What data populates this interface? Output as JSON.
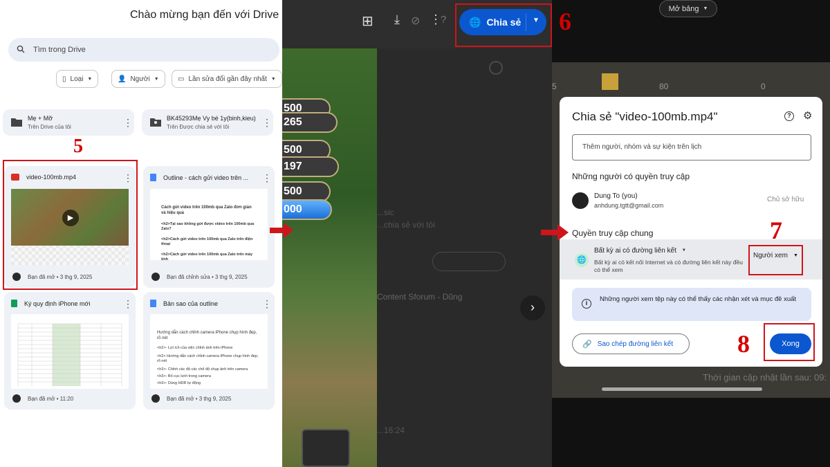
{
  "drive": {
    "welcome": "Chào mừng bạn đến với Drive",
    "search_placeholder": "Tìm trong Drive",
    "filters": [
      "Loại",
      "Người",
      "Lần sửa đổi gần đây nhất"
    ],
    "folders": [
      {
        "name": "Mẹ + Mỡ",
        "location": "Trên Drive của tôi"
      },
      {
        "name": "BK45293Mẹ Vy bé 1y(binh,kieu)",
        "location": "Trên Được chia sẻ với tôi"
      }
    ],
    "files": [
      {
        "name": "video-100mb.mp4",
        "activity": "Bạn đã mở • 3 thg 9, 2025",
        "icon": "video-icon"
      },
      {
        "name": "Outline - cách gửi video trên ...",
        "activity": "Bạn đã chỉnh sửa • 3 thg 9, 2025",
        "icon": "doc-icon"
      },
      {
        "name": "Ký quy định iPhone mới",
        "activity": "Bạn đã mở • 11:20",
        "icon": "sheet-icon"
      },
      {
        "name": "Bản sao của outline",
        "activity": "Bạn đã mở • 3 thg 9, 2025",
        "icon": "doc-icon"
      }
    ],
    "outline_preview": [
      "Cách gửi video trên 100mb qua Zalo đơn giản và hiệu quả",
      "<h2>Tại sao không gửi được video trên 100mb qua Zalo?",
      "<h2>Cách gửi video trên 100mb qua Zalo trên điện thoại",
      "<h2>Cách gửi video trên 100mb qua Zalo trên máy tính"
    ],
    "copy_preview": [
      "Hướng dẫn cách chỉnh camera iPhone chụp hình đẹp, rõ nét",
      "<h2>- Lợi ích của việc chỉnh ảnh trên iPhone",
      "<h2> Hướng dẫn cách chỉnh camera iPhone chụp hình đẹp, rõ nét",
      "<h3>- Chỉnh các độ các chế độ chụp ảnh trên camera",
      "<h3>- Bố cục lưới trong camera",
      "<h3>- Dùng HDR tự động"
    ]
  },
  "video_panel": {
    "share_button": "Chia sẻ",
    "game_values": [
      "500",
      "265",
      "500",
      "197",
      "500",
      "000"
    ],
    "ghost_texts": [
      "...sic",
      "...chia sẻ với tôi",
      "Content Sforum - Dũng",
      "...16:24"
    ]
  },
  "share_panel": {
    "top_button": "Mở bảng",
    "bg_numbers": [
      "80",
      "0",
      "5"
    ],
    "bg_footer": "Thời gian cập nhật lần sau: 09:",
    "dialog": {
      "title": "Chia sẻ \"video-100mb.mp4\"",
      "add_placeholder": "Thêm người, nhóm và sự kiện trên lịch",
      "people_heading": "Những người có quyền truy cập",
      "user_name": "Dung To (you)",
      "user_email": "anhdung.tgtt@gmail.com",
      "user_role": "Chủ sở hữu",
      "general_heading": "Quyền truy cập chung",
      "access_option": "Bất kỳ ai có đường liên kết",
      "access_desc": "Bất kỳ ai có kết nối Internet và có đường liên kết này đều có thể xem",
      "role_select": "Người xem",
      "info_text": "Những người xem tệp này có thể thấy các nhận xét và mục đề xuất",
      "copy_link": "Sao chép đường liên kết",
      "done": "Xong"
    }
  },
  "annotations": {
    "step5": "5",
    "step6": "6",
    "step7": "7",
    "step8": "8"
  },
  "colors": {
    "accent": "#0b57d0",
    "annotation": "#d0141b",
    "card_bg": "#eef1f6"
  }
}
